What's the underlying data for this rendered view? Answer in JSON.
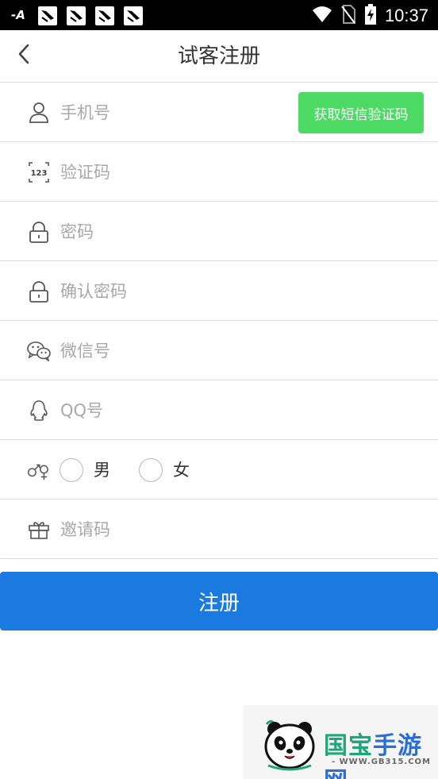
{
  "status_bar": {
    "time": "10:37",
    "left_icons": [
      "font-icon",
      "notification-icon",
      "notification-icon",
      "notification-icon",
      "notification-icon"
    ],
    "right_icons": [
      "wifi-icon",
      "no-sim-icon",
      "battery-charging-icon"
    ]
  },
  "header": {
    "title": "试客注册",
    "back_icon": "chevron-left-icon"
  },
  "form": {
    "phone": {
      "placeholder": "手机号",
      "icon": "user-icon"
    },
    "sms_button_label": "获取短信验证码",
    "code": {
      "placeholder": "验证码",
      "icon": "number-123-icon"
    },
    "password": {
      "placeholder": "密码",
      "icon": "lock-icon"
    },
    "confirm_password": {
      "placeholder": "确认密码",
      "icon": "lock-icon"
    },
    "wechat": {
      "placeholder": "微信号",
      "icon": "wechat-icon"
    },
    "qq": {
      "placeholder": "QQ号",
      "icon": "qq-penguin-icon"
    },
    "gender": {
      "icon": "gender-icon",
      "male_label": "男",
      "female_label": "女"
    },
    "invite": {
      "placeholder": "邀请码",
      "icon": "gift-icon"
    }
  },
  "register_button_label": "注册",
  "watermark": {
    "name_part1": "国宝",
    "name_part2": "手游网",
    "url": "- WWW.GB315.COM -"
  },
  "colors": {
    "sms_button": "#4cd964",
    "register_button": "#1a7ae0",
    "status_bar": "#000000",
    "divider": "#dcdcdc",
    "placeholder": "#a8a8a8"
  }
}
